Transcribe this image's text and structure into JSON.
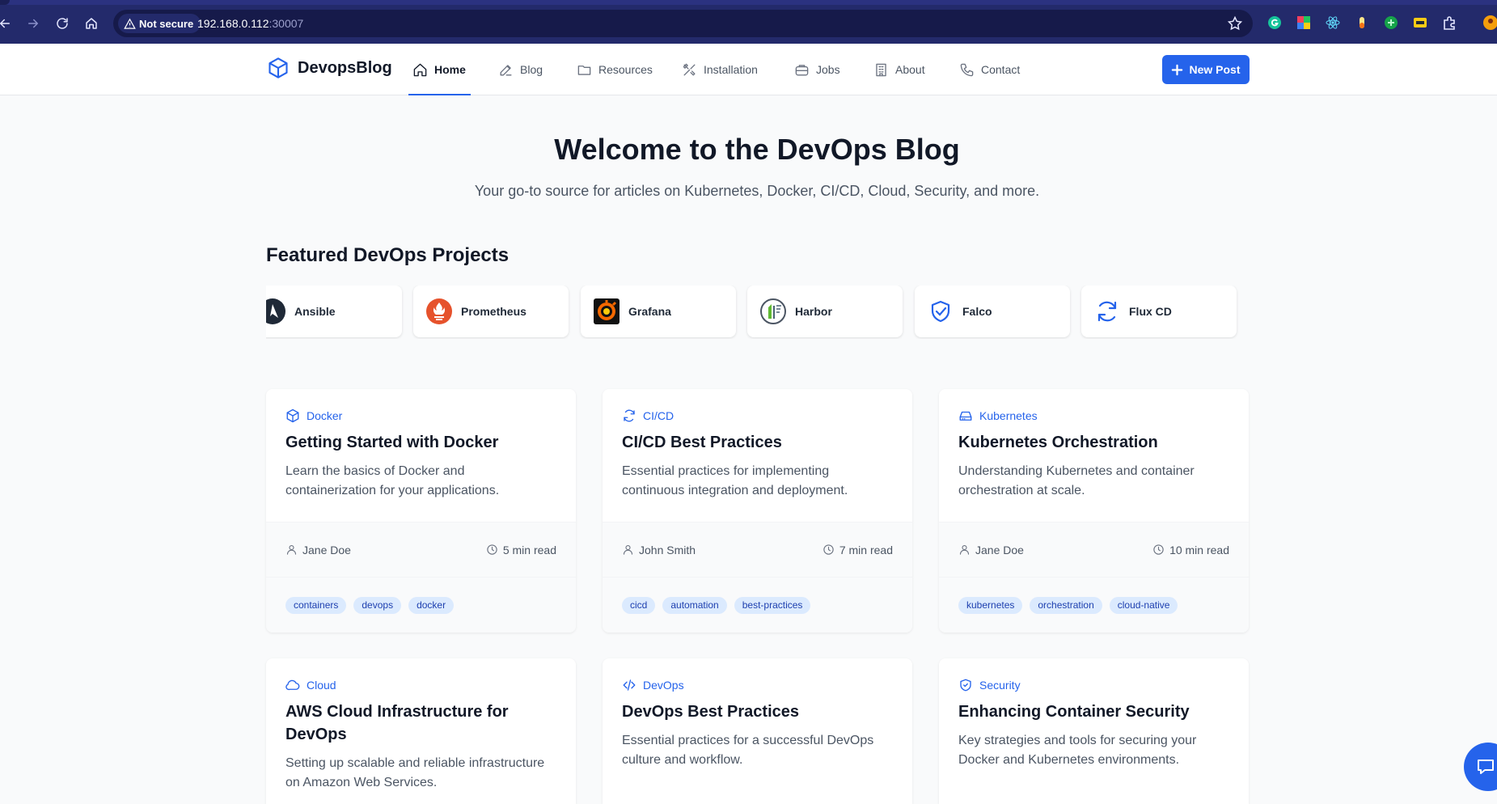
{
  "browser": {
    "security_label": "Not secure",
    "url_host": "192.168.0.112",
    "url_port": ":30007"
  },
  "navbar": {
    "brand": "DevopsBlog",
    "items": [
      {
        "label": "Home",
        "icon": "home-icon",
        "active": true
      },
      {
        "label": "Blog",
        "icon": "edit-icon",
        "active": false
      },
      {
        "label": "Resources",
        "icon": "folder-icon",
        "active": false
      },
      {
        "label": "Installation",
        "icon": "tools-icon",
        "active": false
      },
      {
        "label": "Jobs",
        "icon": "briefcase-icon",
        "active": false
      },
      {
        "label": "About",
        "icon": "building-icon",
        "active": false
      },
      {
        "label": "Contact",
        "icon": "phone-icon",
        "active": false
      }
    ],
    "new_post_label": "New Post",
    "accent_color": "#2563eb"
  },
  "hero": {
    "title": "Welcome to the DevOps Blog",
    "subtitle": "Your go-to source for articles on Kubernetes, Docker, CI/CD, Cloud, Security, and more."
  },
  "featured": {
    "title": "Featured DevOps Projects",
    "projects": [
      {
        "name": "Ansible",
        "icon": "ansible-logo"
      },
      {
        "name": "Prometheus",
        "icon": "prometheus-logo"
      },
      {
        "name": "Grafana",
        "icon": "grafana-logo"
      },
      {
        "name": "Harbor",
        "icon": "harbor-logo"
      },
      {
        "name": "Falco",
        "icon": "shield-check-icon"
      },
      {
        "name": "Flux CD",
        "icon": "refresh-icon"
      }
    ]
  },
  "posts": [
    {
      "category": "Docker",
      "icon": "box-icon",
      "title": "Getting Started with Docker",
      "description": "Learn the basics of Docker and containerization for your applications.",
      "author": "Jane Doe",
      "read_time": "5 min read",
      "tags": [
        "containers",
        "devops",
        "docker"
      ]
    },
    {
      "category": "CI/CD",
      "icon": "refresh-icon",
      "title": "CI/CD Best Practices",
      "description": "Essential practices for implementing continuous integration and deployment.",
      "author": "John Smith",
      "read_time": "7 min read",
      "tags": [
        "cicd",
        "automation",
        "best-practices"
      ]
    },
    {
      "category": "Kubernetes",
      "icon": "hard-drive-icon",
      "title": "Kubernetes Orchestration",
      "description": "Understanding Kubernetes and container orchestration at scale.",
      "author": "Jane Doe",
      "read_time": "10 min read",
      "tags": [
        "kubernetes",
        "orchestration",
        "cloud-native"
      ]
    },
    {
      "category": "Cloud",
      "icon": "cloud-icon",
      "title": "AWS Cloud Infrastructure for DevOps",
      "description": "Setting up scalable and reliable infrastructure on Amazon Web Services."
    },
    {
      "category": "DevOps",
      "icon": "code-icon",
      "title": "DevOps Best Practices",
      "description": "Essential practices for a successful DevOps culture and workflow."
    },
    {
      "category": "Security",
      "icon": "shield-icon",
      "title": "Enhancing Container Security",
      "description": "Key strategies and tools for securing your Docker and Kubernetes environments."
    }
  ]
}
